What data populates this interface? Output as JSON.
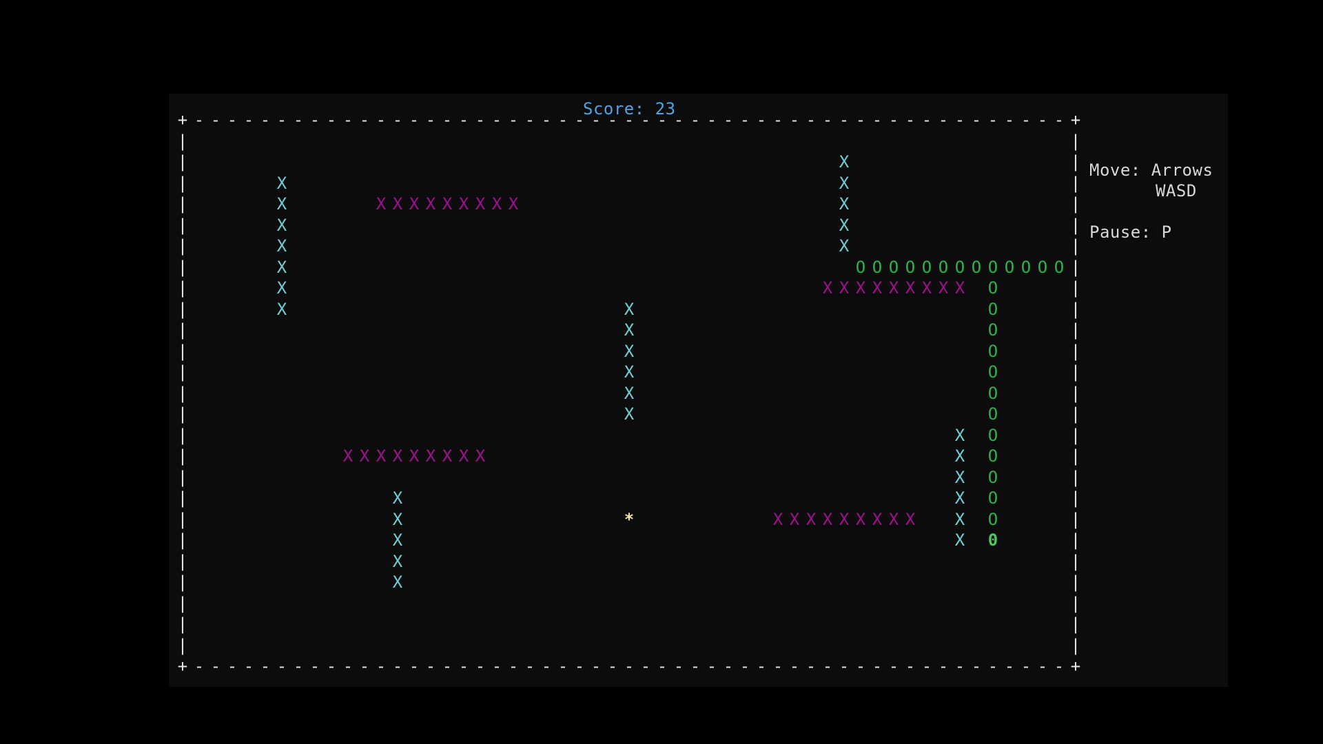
{
  "score_label": "Score: 23",
  "help": {
    "move": "Move: Arrows",
    "move_alt": "WASD",
    "pause": "Pause: P"
  },
  "colors": {
    "background": "#000000",
    "terminal_bg": "#0c0c0c",
    "score": "#4fa3e3",
    "border": "#e6e6e6",
    "help_text": "#d8d8d8",
    "static_wall": "#6fd0d6",
    "moving_wall": "#a0108f",
    "snake_body": "#2fb14a",
    "snake_head": "#49c85e",
    "food": "#f5e6a8"
  },
  "glyphs": {
    "corner": "+",
    "h_border": "-",
    "v_border": "|",
    "static_wall": "X",
    "moving_wall": "X",
    "snake_body": "O",
    "snake_head": "0",
    "food": "*"
  },
  "grid": {
    "cols": 53,
    "rows": 25
  },
  "static_walls": [
    {
      "col": 6,
      "row": 3,
      "length": 7,
      "orientation": "vertical"
    },
    {
      "col": 40,
      "row": 2,
      "length": 5,
      "orientation": "vertical"
    },
    {
      "col": 27,
      "row": 9,
      "length": 6,
      "orientation": "vertical"
    },
    {
      "col": 13,
      "row": 18,
      "length": 5,
      "orientation": "vertical"
    },
    {
      "col": 47,
      "row": 15,
      "length": 6,
      "orientation": "vertical"
    }
  ],
  "moving_walls": [
    {
      "col": 12,
      "row": 4,
      "length": 9
    },
    {
      "col": 39,
      "row": 8,
      "length": 9
    },
    {
      "col": 10,
      "row": 16,
      "length": 9
    },
    {
      "col": 36,
      "row": 19,
      "length": 9
    }
  ],
  "snake": {
    "top_run": {
      "col": 41,
      "row": 7,
      "length": 13
    },
    "column": {
      "col": 49,
      "row": 8,
      "length": 12
    },
    "head": {
      "col": 49,
      "row": 20
    }
  },
  "food": {
    "col": 27,
    "row": 19
  }
}
